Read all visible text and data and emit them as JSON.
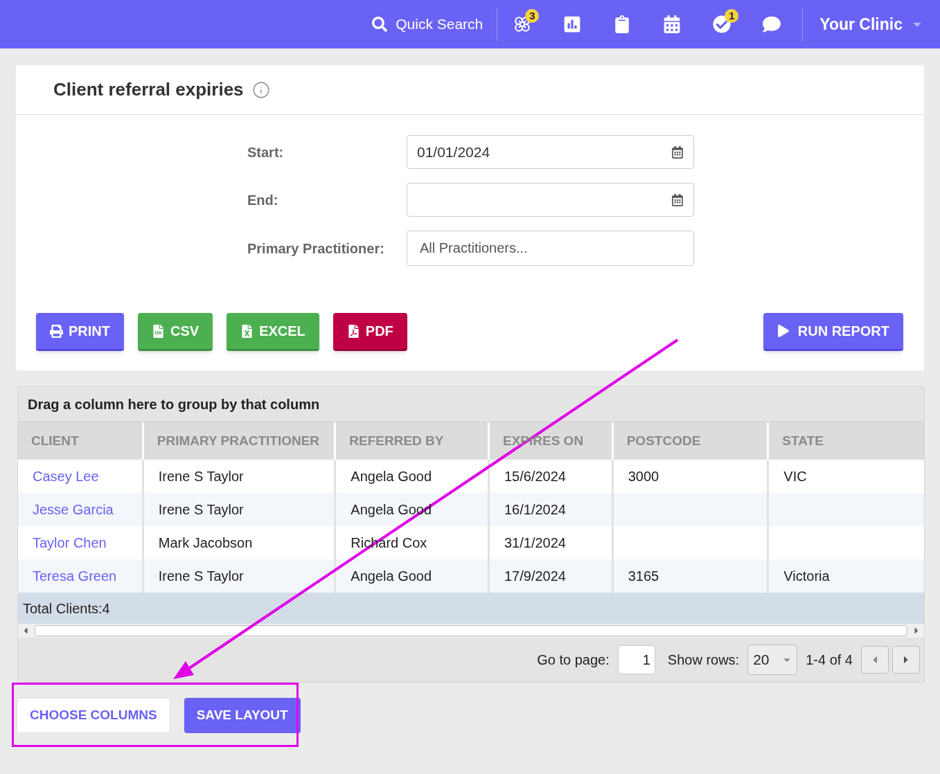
{
  "header": {
    "search_label": "Quick Search",
    "icons": [
      {
        "kind": "network",
        "badge": "3"
      },
      {
        "kind": "chart"
      },
      {
        "kind": "clipboard"
      },
      {
        "kind": "calendar"
      },
      {
        "kind": "check",
        "badge": "1"
      },
      {
        "kind": "chat"
      }
    ],
    "clinic": "Your Clinic"
  },
  "report": {
    "title": "Client referral expiries",
    "filters": [
      {
        "label": "Start:",
        "kind": "date",
        "value": "01/01/2024"
      },
      {
        "label": "End:",
        "kind": "date"
      },
      {
        "label": "Primary Practitioner:",
        "kind": "select",
        "placeholder": "All Practitioners..."
      }
    ],
    "export_buttons": [
      {
        "label": "PRINT",
        "kind": "print"
      },
      {
        "label": "CSV",
        "kind": "csv"
      },
      {
        "label": "EXCEL",
        "kind": "excel"
      },
      {
        "label": "PDF",
        "kind": "pdf"
      }
    ],
    "run_button": "RUN REPORT"
  },
  "grid": {
    "group_hint": "Drag a column here to group by that column",
    "columns": [
      "CLIENT",
      "PRIMARY PRACTITIONER",
      "REFERRED BY",
      "EXPIRES ON",
      "POSTCODE",
      "STATE"
    ],
    "rows": [
      [
        "Casey Lee",
        "Irene S Taylor",
        "Angela Good",
        "15/6/2024",
        "3000",
        "VIC"
      ],
      [
        "Jesse Garcia",
        "Irene S Taylor",
        "Angela Good",
        "16/1/2024",
        null,
        null
      ],
      [
        "Taylor Chen",
        "Mark Jacobson",
        "Richard Cox",
        "31/1/2024",
        null,
        null
      ],
      [
        "Teresa Green",
        "Irene S Taylor",
        "Angela Good",
        "17/9/2024",
        "3165",
        "Victoria"
      ]
    ],
    "footer": "Total Clients:4",
    "pager": {
      "go_label": "Go to page:",
      "page": "1",
      "rows_label": "Show rows:",
      "rows_value": "20",
      "range": "1-4 of 4"
    }
  },
  "bottom_buttons": [
    {
      "label": "CHOOSE COLUMNS",
      "kind": "outline"
    },
    {
      "label": "SAVE LAYOUT",
      "kind": "primary"
    }
  ]
}
